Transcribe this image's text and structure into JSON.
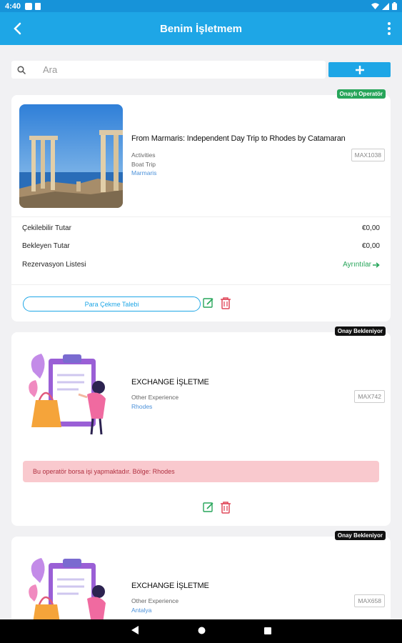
{
  "status": {
    "time": "4:40"
  },
  "appbar": {
    "title": "Benim İşletmem"
  },
  "search": {
    "placeholder": "Ara"
  },
  "cards": [
    {
      "badge": "Onaylı Operatör",
      "title": "From Marmaris: Independent Day Trip to Rhodes by Catamaran",
      "category": "Activities",
      "subcategory": "Boat Trip",
      "location": "Marmaris",
      "code": "MAX1038",
      "rows": [
        {
          "label": "Çekilebilir Tutar",
          "value": "€0,00"
        },
        {
          "label": "Bekleyen Tutar",
          "value": "€0,00"
        },
        {
          "label": "Rezervasyon Listesi",
          "value": "Ayrıntılar"
        }
      ],
      "withdraw_label": "Para Çekme Talebi"
    },
    {
      "badge": "Onay Bekleniyor",
      "title": "EXCHANGE İŞLETME",
      "category": "Other Experience",
      "location": "Rhodes",
      "code": "MAX742",
      "notice": "Bu operatör borsa işi yapmaktadır. Bölge: Rhodes"
    },
    {
      "badge": "Onay Bekleniyor",
      "title": "EXCHANGE İŞLETME",
      "category": "Other Experience",
      "location": "Antalya",
      "code": "MAX658"
    }
  ],
  "colors": {
    "primary": "#1ea6e6",
    "status_bar": "#1793d9",
    "approved": "#27a55a",
    "pending": "#111111",
    "notice_bg": "#f9c9ce",
    "delete": "#e0485a"
  }
}
